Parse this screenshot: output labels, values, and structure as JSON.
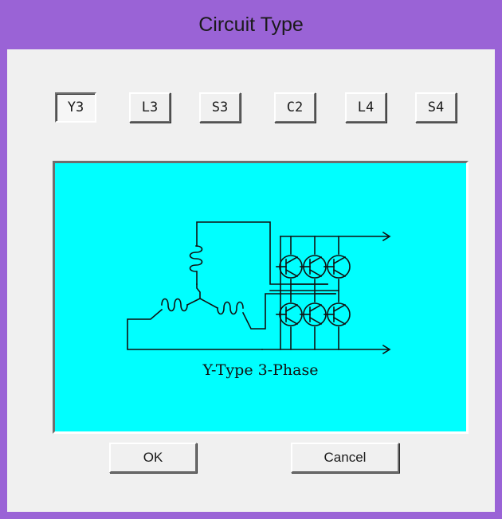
{
  "window": {
    "title": "Circuit Type",
    "frame_color": "#9a63d6"
  },
  "circuit_buttons": [
    "Y3",
    "L3",
    "S3",
    "C2",
    "L4",
    "S4"
  ],
  "selected_button": "Y3",
  "preview": {
    "background": "#00ffff",
    "caption": "Y-Type 3-Phase",
    "diagram_icon": "y-type-3-phase-inverter-schematic"
  },
  "actions": {
    "ok_label": "OK",
    "cancel_label": "Cancel"
  }
}
